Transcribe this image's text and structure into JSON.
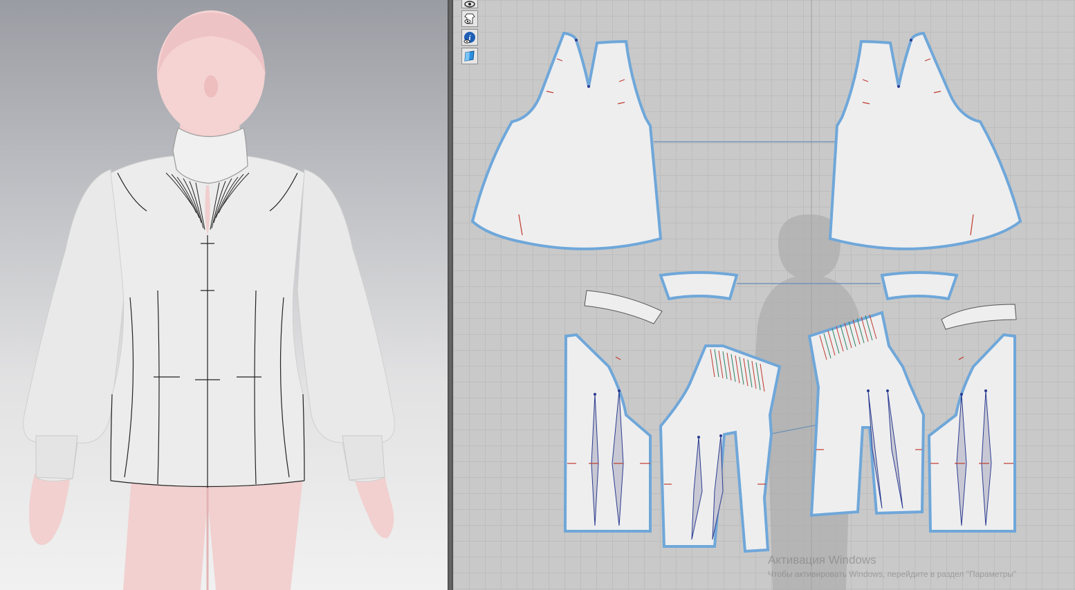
{
  "window": {
    "panes": [
      "3d-garment-viewport",
      "2d-pattern-window"
    ]
  },
  "toolbar2d": {
    "tools": [
      {
        "icon": "eye-icon"
      },
      {
        "icon": "garment-visibility-icon"
      },
      {
        "icon": "info-icon"
      },
      {
        "icon": "texture-icon"
      }
    ]
  },
  "colors": {
    "fabric": "#ebebeb",
    "pattern_outline": "#6fa7d9",
    "pattern_fill": "#eeeeef",
    "avatar_skin": "#f3d2d2",
    "viewport_top": "#9a9ca3",
    "grid_bg": "#c9c9c9",
    "pin_red": "#c0392b",
    "pin_blue": "#2a3b8f"
  },
  "watermark": {
    "title": "Активация Windows",
    "subtitle": "Чтобы активировать Windows, перейдите в раздел \"Параметры\""
  }
}
